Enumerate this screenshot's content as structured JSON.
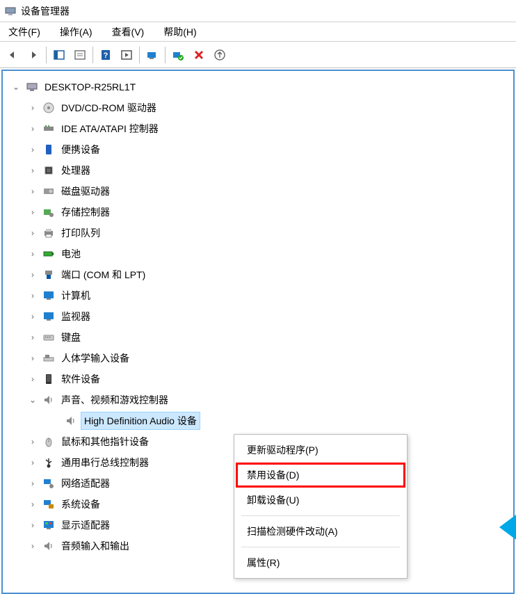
{
  "title": "设备管理器",
  "menus": {
    "file": "文件(F)",
    "action": "操作(A)",
    "view": "查看(V)",
    "help": "帮助(H)"
  },
  "root": "DESKTOP-R25RL1T",
  "categories": [
    {
      "label": "DVD/CD-ROM 驱动器",
      "expanded": false
    },
    {
      "label": "IDE ATA/ATAPI 控制器",
      "expanded": false
    },
    {
      "label": "便携设备",
      "expanded": false
    },
    {
      "label": "处理器",
      "expanded": false
    },
    {
      "label": "磁盘驱动器",
      "expanded": false
    },
    {
      "label": "存储控制器",
      "expanded": false
    },
    {
      "label": "打印队列",
      "expanded": false
    },
    {
      "label": "电池",
      "expanded": false
    },
    {
      "label": "端口 (COM 和 LPT)",
      "expanded": false
    },
    {
      "label": "计算机",
      "expanded": false
    },
    {
      "label": "监视器",
      "expanded": false
    },
    {
      "label": "键盘",
      "expanded": false
    },
    {
      "label": "人体学输入设备",
      "expanded": false
    },
    {
      "label": "软件设备",
      "expanded": false
    },
    {
      "label": "声音、视频和游戏控制器",
      "expanded": true,
      "children": [
        {
          "label": "High Definition Audio 设备",
          "selected": true
        }
      ]
    },
    {
      "label": "鼠标和其他指针设备",
      "expanded": false
    },
    {
      "label": "通用串行总线控制器",
      "expanded": false
    },
    {
      "label": "网络适配器",
      "expanded": false
    },
    {
      "label": "系统设备",
      "expanded": false
    },
    {
      "label": "显示适配器",
      "expanded": false
    },
    {
      "label": "音频输入和输出",
      "expanded": false
    }
  ],
  "contextMenu": {
    "update_driver": "更新驱动程序(P)",
    "disable_device": "禁用设备(D)",
    "uninstall_device": "卸载设备(U)",
    "scan_hardware": "扫描检测硬件改动(A)",
    "properties": "属性(R)"
  }
}
